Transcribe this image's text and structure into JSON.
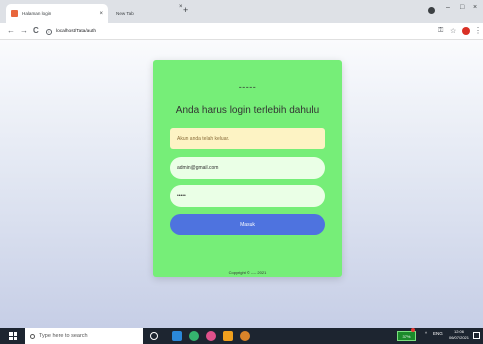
{
  "browser": {
    "tabs": [
      {
        "label": "Halaman login",
        "close": "×"
      },
      {
        "label": "New Tab",
        "close": "×"
      }
    ],
    "new_tab": "+",
    "window_controls": {
      "minimize": "–",
      "maximize": "□",
      "close": "×"
    },
    "nav": {
      "back": "←",
      "forward": "→",
      "reload": "C"
    },
    "address": "localhost/Tata/auth",
    "toolbar_icons": {
      "key": "⚿",
      "star": "☆",
      "menu": "⋮"
    }
  },
  "login": {
    "logo_text": "-----",
    "title": "Anda harus login terlebih dahulu",
    "alert": "Akun anda telah keluar.",
    "email_value": "admin@gmail.com",
    "password_value": "•••••",
    "submit_label": "Masuk",
    "footer": "Copyright © ---- 2021"
  },
  "taskbar": {
    "search_placeholder": "Type here to search",
    "battery": "37%",
    "tray_arrow": "^",
    "language": "ENG",
    "time": "12:06",
    "date": "06/07/2021"
  },
  "colors": {
    "card": "#76ee78",
    "alert": "#fdf3c4",
    "field": "#eaffe6",
    "button": "#4e73df",
    "taskbar": "#1d2530"
  }
}
